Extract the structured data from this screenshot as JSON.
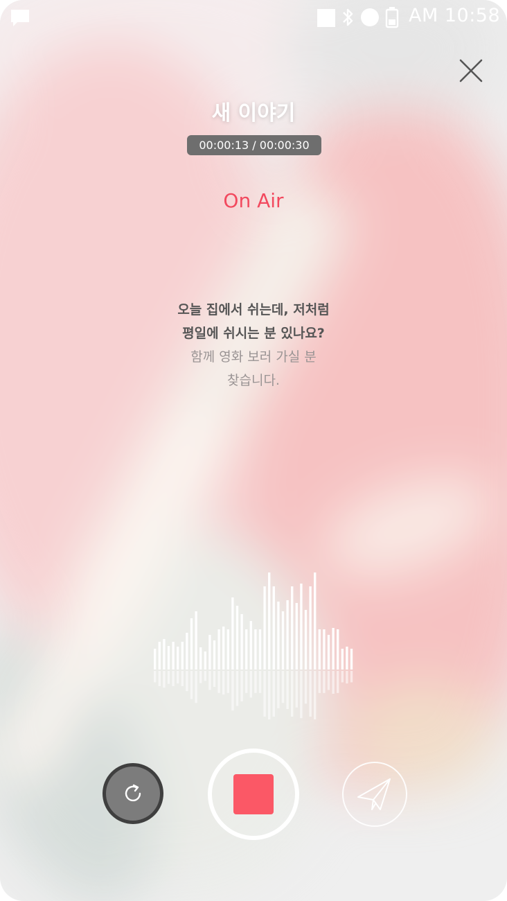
{
  "status_bar": {
    "time": "AM 10:58",
    "icons": [
      "chat-icon",
      "square-icon",
      "bluetooth-icon",
      "circle-icon",
      "battery-icon"
    ]
  },
  "header": {
    "close_icon": "close-icon",
    "title": "새 이야기",
    "timer": "00:00:13 / 00:00:30"
  },
  "recording": {
    "status": "On Air",
    "status_color": "#f2495e",
    "elapsed_seconds": 13,
    "total_seconds": 30
  },
  "message": {
    "lines": [
      "오늘 집에서 쉬는데, 저처럼",
      "평일에 쉬시는 분 있나요?",
      "함께 영화 보러 가실 분",
      "찾습니다."
    ]
  },
  "waveform": {
    "levels": [
      30,
      40,
      44,
      34,
      40,
      33,
      40,
      53,
      74,
      84,
      32,
      26,
      50,
      42,
      58,
      62,
      58,
      104,
      92,
      80,
      58,
      70,
      58,
      58,
      120,
      140,
      120,
      98,
      84,
      100,
      120,
      96,
      124,
      86,
      120,
      140,
      58,
      58,
      50,
      60,
      58,
      30,
      33,
      30
    ]
  },
  "controls": {
    "reset_icon": "refresh-icon",
    "stop_icon": "stop-icon",
    "stop_color": "#fb5866",
    "send_icon": "paper-plane-icon"
  }
}
